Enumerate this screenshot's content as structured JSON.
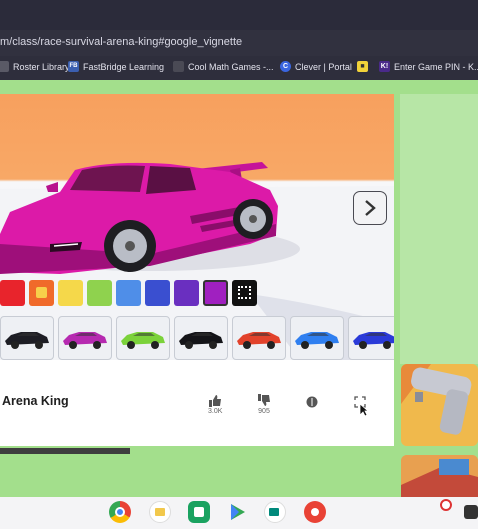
{
  "browser": {
    "url": "m/class/race-survival-arena-king#google_vignette",
    "bookmarks": [
      {
        "label": "Roster Library",
        "icon": "page-icon"
      },
      {
        "label": "FastBridge Learning",
        "icon": "fastbridge-icon"
      },
      {
        "label": "Cool Math Games -...",
        "icon": "coolmath-icon"
      },
      {
        "label": "Clever | Portal",
        "icon": "clever-icon"
      },
      {
        "label": "",
        "icon": "kahoot-icon"
      },
      {
        "label": "Enter Game PIN - K...",
        "icon": "kahoot-k-icon"
      }
    ]
  },
  "game": {
    "title": "Arena King",
    "swatch_colors": [
      "#e8242c",
      "#f06a2a",
      "#f5d84a",
      "#8fd24e",
      "#4f8ee8",
      "#3a4fd0",
      "#6a2fc0",
      "#a020c0",
      "#111111"
    ],
    "selected_swatch": 7,
    "car_thumbs": [
      {
        "color": "#1d1d24",
        "icon": "black-car-icon"
      },
      {
        "color": "#b62ab0",
        "icon": "magenta-car-icon"
      },
      {
        "color": "#7bd23a",
        "icon": "green-car-icon"
      },
      {
        "color": "#141418",
        "icon": "black-car-icon"
      },
      {
        "color": "#e2422b",
        "icon": "red-car-icon"
      },
      {
        "color": "#2f7ff0",
        "icon": "blue-car-icon"
      },
      {
        "color": "#2a3ad8",
        "icon": "blue-car-icon"
      }
    ]
  },
  "actions": {
    "likes": "3.0K",
    "dislikes": "905"
  },
  "colors": {
    "page_bg": "#a3df8c",
    "car_body": "#dc1aa8",
    "sky": "#f7a05e"
  }
}
